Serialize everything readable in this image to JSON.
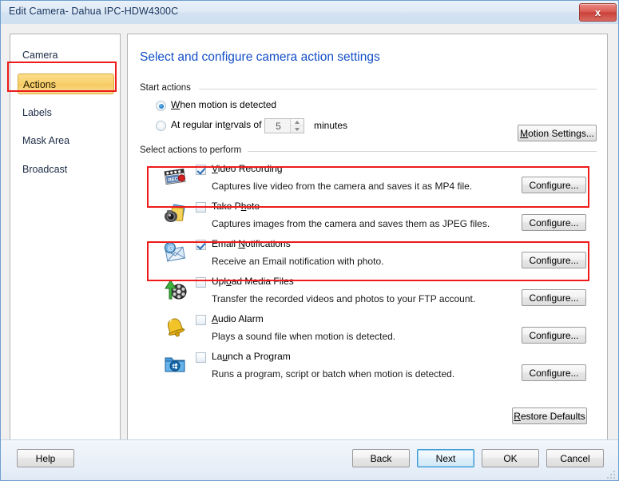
{
  "window": {
    "title": "Edit Camera- Dahua IPC-HDW4300C",
    "close_label": "x"
  },
  "sidebar": {
    "items": [
      {
        "label": "Camera",
        "selected": false
      },
      {
        "label": "Actions",
        "selected": true
      },
      {
        "label": "Labels",
        "selected": false
      },
      {
        "label": "Mask Area",
        "selected": false
      },
      {
        "label": "Broadcast",
        "selected": false
      }
    ]
  },
  "main": {
    "page_title": "Select and configure camera action settings",
    "start_actions": {
      "group_label": "Start actions",
      "option_motion": "When motion is detected",
      "option_motion_accel": "W",
      "option_motion_rest": "hen motion is detected",
      "option_interval_pre": "At regular int",
      "option_interval_accel": "e",
      "option_interval_rest": "rvals of",
      "interval_value": "5",
      "interval_unit": "minutes",
      "motion_settings_accel": "M",
      "motion_settings_rest": "otion Settings...",
      "selected": "When motion is detected"
    },
    "select_actions": {
      "group_label": "Select actions to perform",
      "configure_label": "Configure...",
      "restore_defaults_accel": "R",
      "restore_defaults_rest": "estore Defaults",
      "items": [
        {
          "icon": "video-recording-icon",
          "title_pre": "Video Recording",
          "accel": "V",
          "title_rest": "ideo Recording",
          "desc": "Captures live video from the camera and saves it as MP4 file.",
          "checked": true,
          "highlighted": true,
          "configure": "Configure..."
        },
        {
          "icon": "take-photo-icon",
          "title_pre": "Take P",
          "accel": "h",
          "title_rest": "oto",
          "desc": "Captures images from the camera and saves them as JPEG files.",
          "checked": false,
          "highlighted": false,
          "configure": "Configure..."
        },
        {
          "icon": "email-notifications-icon",
          "title_pre": "Email ",
          "accel": "N",
          "title_rest": "otifications",
          "desc": "Receive an Email notification with photo.",
          "checked": true,
          "highlighted": true,
          "configure": "Configure..."
        },
        {
          "icon": "upload-media-files-icon",
          "title_pre": "Upl",
          "accel": "o",
          "title_rest": "ad Media Files",
          "desc": "Transfer the recorded videos and photos to your FTP account.",
          "checked": false,
          "highlighted": false,
          "configure": "Configure..."
        },
        {
          "icon": "audio-alarm-icon",
          "title_pre": "",
          "accel": "A",
          "title_rest": "udio Alarm",
          "desc": "Plays a sound file when motion is detected.",
          "checked": false,
          "highlighted": false,
          "configure": "Configure..."
        },
        {
          "icon": "launch-program-icon",
          "title_pre": "La",
          "accel": "u",
          "title_rest": "nch a Program",
          "desc": "Runs a program, script or batch when motion is detected.",
          "checked": false,
          "highlighted": false,
          "configure": "Configure..."
        }
      ]
    }
  },
  "footer": {
    "help": "Help",
    "back": "Back",
    "next": "Next",
    "ok": "OK",
    "cancel": "Cancel",
    "focused_button": "Next"
  },
  "colors": {
    "title_blue": "#1450c8",
    "selection_gold": "#f8d06b",
    "annotation_red": "#ee1b1b",
    "focus_blue": "#3c99d4"
  }
}
